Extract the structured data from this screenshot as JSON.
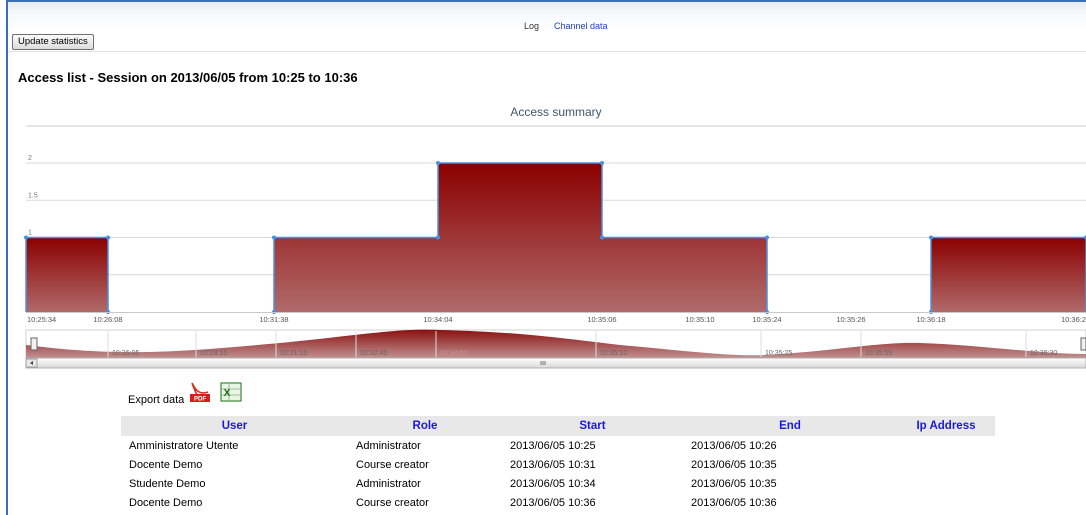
{
  "nav": {
    "tabs": [
      {
        "label": "Log"
      },
      {
        "label": "Channel data"
      }
    ]
  },
  "toolbar": {
    "update_label": "Update statistics"
  },
  "page": {
    "title": "Access list - Session on 2013/06/05 from 10:25 to 10:36"
  },
  "chart_data": {
    "type": "area",
    "title": "Access summary",
    "y_ticks": [
      "2",
      "1.5",
      "1",
      "0.5"
    ],
    "ylim": [
      0,
      2
    ],
    "x_tick_labels": [
      "10:25:34",
      "10:26:08",
      "10:31:38",
      "10:34:04",
      "10:35:06",
      "10:35:10",
      "10:35:24",
      "10:35:26",
      "10:36:18",
      "10:36:2"
    ],
    "series": [
      {
        "values": [
          [
            "10:25:34",
            1
          ],
          [
            "10:26:08",
            1
          ],
          [
            "10:26:08",
            0
          ],
          [
            "10:31:38",
            0
          ],
          [
            "10:31:38",
            1
          ],
          [
            "10:34:04",
            1
          ],
          [
            "10:34:04",
            2
          ],
          [
            "10:35:06",
            2
          ],
          [
            "10:35:06",
            1
          ],
          [
            "10:35:24",
            1
          ],
          [
            "10:35:24",
            0
          ],
          [
            "10:36:18",
            0
          ],
          [
            "10:36:18",
            1
          ],
          [
            "10:36:2",
            1
          ]
        ]
      }
    ],
    "navigator_labels": [
      "10:26:05",
      "10:29:15",
      "10:31:15",
      "10:32:45",
      "10:34:00",
      "10:35:10",
      "10:35:25",
      "10:35:55",
      "10:36:30"
    ],
    "colors": {
      "fill_top": "#8b0000",
      "fill_bottom": "#b06a6a",
      "line": "#4a90e2",
      "grid": "#d8d8d8",
      "title": "#3e576f"
    }
  },
  "export": {
    "label": "Export data",
    "icons": [
      "pdf-icon",
      "excel-icon"
    ],
    "pdf_text": "PDF",
    "excel_text": "X"
  },
  "table": {
    "headers": [
      "User",
      "Role",
      "Start",
      "End",
      "Ip Address"
    ],
    "rows": [
      [
        "Amministratore Utente",
        "Administrator",
        "2013/06/05 10:25",
        "2013/06/05 10:26",
        ""
      ],
      [
        "Docente Demo",
        "Course creator",
        "2013/06/05 10:31",
        "2013/06/05 10:35",
        ""
      ],
      [
        "Studente Demo",
        "Administrator",
        "2013/06/05 10:34",
        "2013/06/05 10:35",
        ""
      ],
      [
        "Docente Demo",
        "Course creator",
        "2013/06/05 10:36",
        "2013/06/05 10:36",
        ""
      ]
    ]
  }
}
